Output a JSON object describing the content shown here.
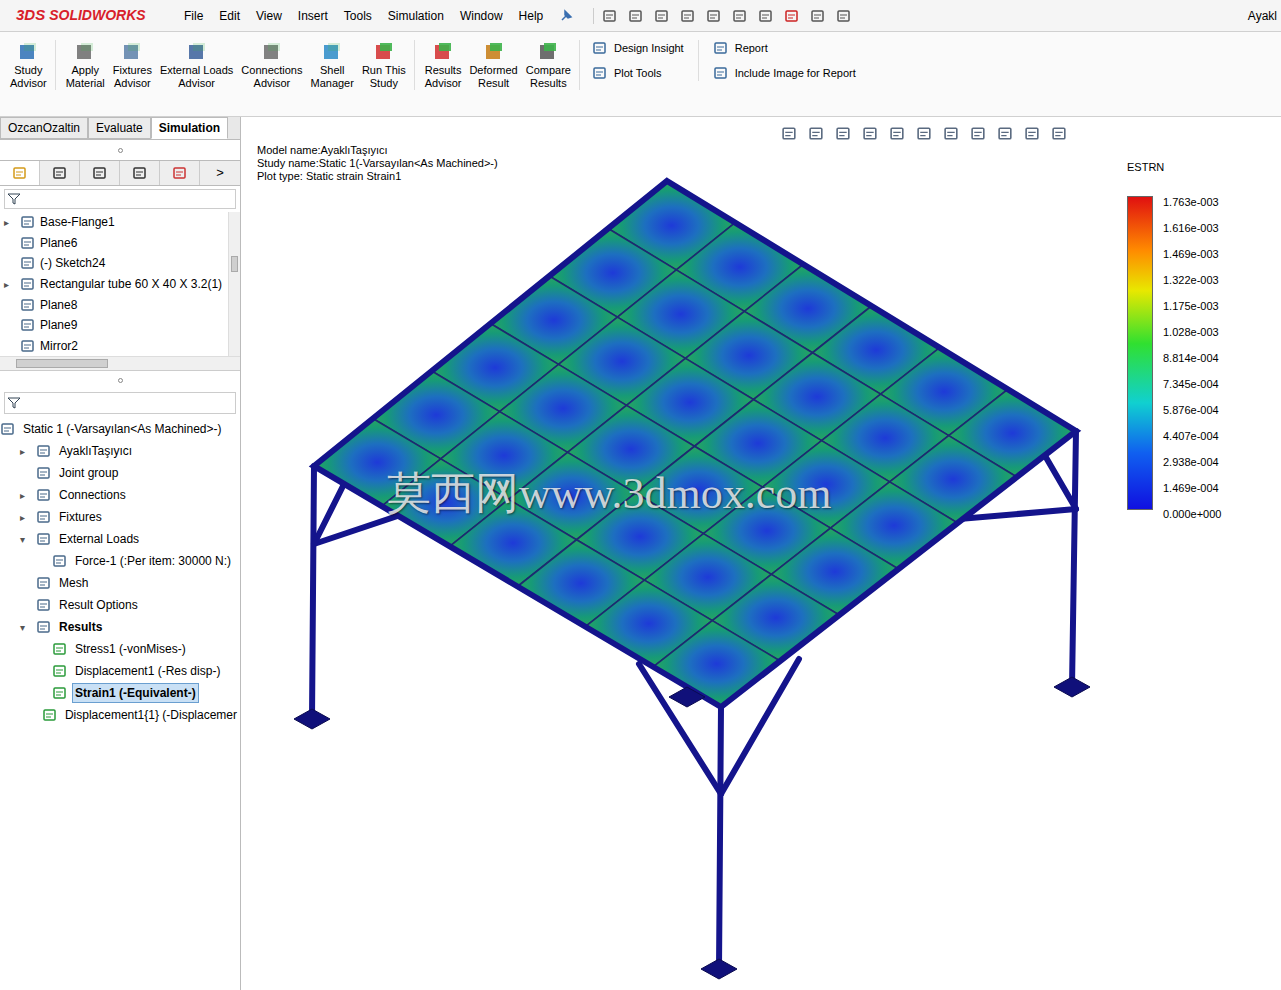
{
  "window": {
    "title": "Ayakl"
  },
  "logo": {
    "mark": "3DS",
    "text": "SOLIDWORKS"
  },
  "menu": [
    "File",
    "Edit",
    "View",
    "Insert",
    "Tools",
    "Simulation",
    "Window",
    "Help"
  ],
  "ribbon": {
    "large": [
      [
        "Study",
        "Advisor"
      ],
      [
        "Apply",
        "Material"
      ],
      [
        "Fixtures",
        "Advisor"
      ],
      [
        "External Loads",
        "Advisor"
      ],
      [
        "Connections",
        "Advisor"
      ],
      [
        "Shell",
        "Manager"
      ],
      [
        "Run This",
        "Study"
      ],
      [
        "Results",
        "Advisor"
      ],
      [
        "Deformed",
        "Result"
      ],
      [
        "Compare",
        "Results"
      ]
    ],
    "smallGroups": [
      [
        "Design Insight",
        "Plot Tools"
      ],
      [
        "Report",
        "Include Image for Report"
      ]
    ]
  },
  "tabs": [
    {
      "label": "OzcanOzaltin",
      "selected": false
    },
    {
      "label": "Evaluate",
      "selected": false
    },
    {
      "label": "Simulation",
      "selected": true
    }
  ],
  "panelTabs": {
    "more": ">"
  },
  "featureTree": [
    {
      "label": "Base-Flange1",
      "depth": 0,
      "expanded": false
    },
    {
      "label": "Plane6",
      "depth": 0
    },
    {
      "label": "(-) Sketch24",
      "depth": 0
    },
    {
      "label": "Rectangular tube 60 X 40 X 3.2(1)",
      "depth": 0,
      "expanded": false
    },
    {
      "label": "Plane8",
      "depth": 0
    },
    {
      "label": "Plane9",
      "depth": 0
    },
    {
      "label": "Mirror2",
      "depth": 0
    }
  ],
  "studyTree": [
    {
      "label": "Static 1 (-Varsayılan<As Machined>-)",
      "depth": 0,
      "selected": false,
      "emphasis": false
    },
    {
      "label": "AyaklıTaşıyıcı",
      "depth": 1,
      "expanded": false,
      "selected": false,
      "emphasis": false
    },
    {
      "label": "Joint group",
      "depth": 1,
      "selected": false,
      "emphasis": false
    },
    {
      "label": "Connections",
      "depth": 1,
      "expanded": false,
      "selected": false,
      "emphasis": false
    },
    {
      "label": "Fixtures",
      "depth": 1,
      "expanded": false,
      "selected": false,
      "emphasis": false
    },
    {
      "label": "External Loads",
      "depth": 1,
      "expanded": true,
      "selected": false,
      "emphasis": false
    },
    {
      "label": "Force-1 (:Per item: 30000 N:)",
      "depth": 2,
      "selected": false,
      "emphasis": false
    },
    {
      "label": "Mesh",
      "depth": 1,
      "selected": false,
      "emphasis": false
    },
    {
      "label": "Result Options",
      "depth": 1,
      "selected": false,
      "emphasis": false
    },
    {
      "label": "Results",
      "depth": 1,
      "expanded": true,
      "selected": false,
      "emphasis": true
    },
    {
      "label": "Stress1 (-vonMises-)",
      "depth": 2,
      "selected": false,
      "emphasis": false
    },
    {
      "label": "Displacement1 (-Res disp-)",
      "depth": 2,
      "selected": false,
      "emphasis": false
    },
    {
      "label": "Strain1 (-Equivalent-)",
      "depth": 2,
      "selected": true,
      "emphasis": true
    },
    {
      "label": "Displacement1{1} (-Displacemer",
      "depth": 2,
      "selected": false,
      "emphasis": false
    }
  ],
  "viewport": {
    "header": [
      "Model name:AyaklıTaşıyıcı",
      "Study name:Static 1(-Varsayılan<As Machined>-)",
      "Plot type: Static strain Strain1"
    ],
    "legend": {
      "title": "ESTRN",
      "ticks": [
        "1.763e-003",
        "1.616e-003",
        "1.469e-003",
        "1.322e-003",
        "1.175e-003",
        "1.028e-003",
        "8.814e-004",
        "7.345e-004",
        "5.876e-004",
        "4.407e-004",
        "2.938e-004",
        "1.469e-004",
        "0.000e+000"
      ]
    },
    "watermark": "莫西网www.3dmox.com"
  }
}
